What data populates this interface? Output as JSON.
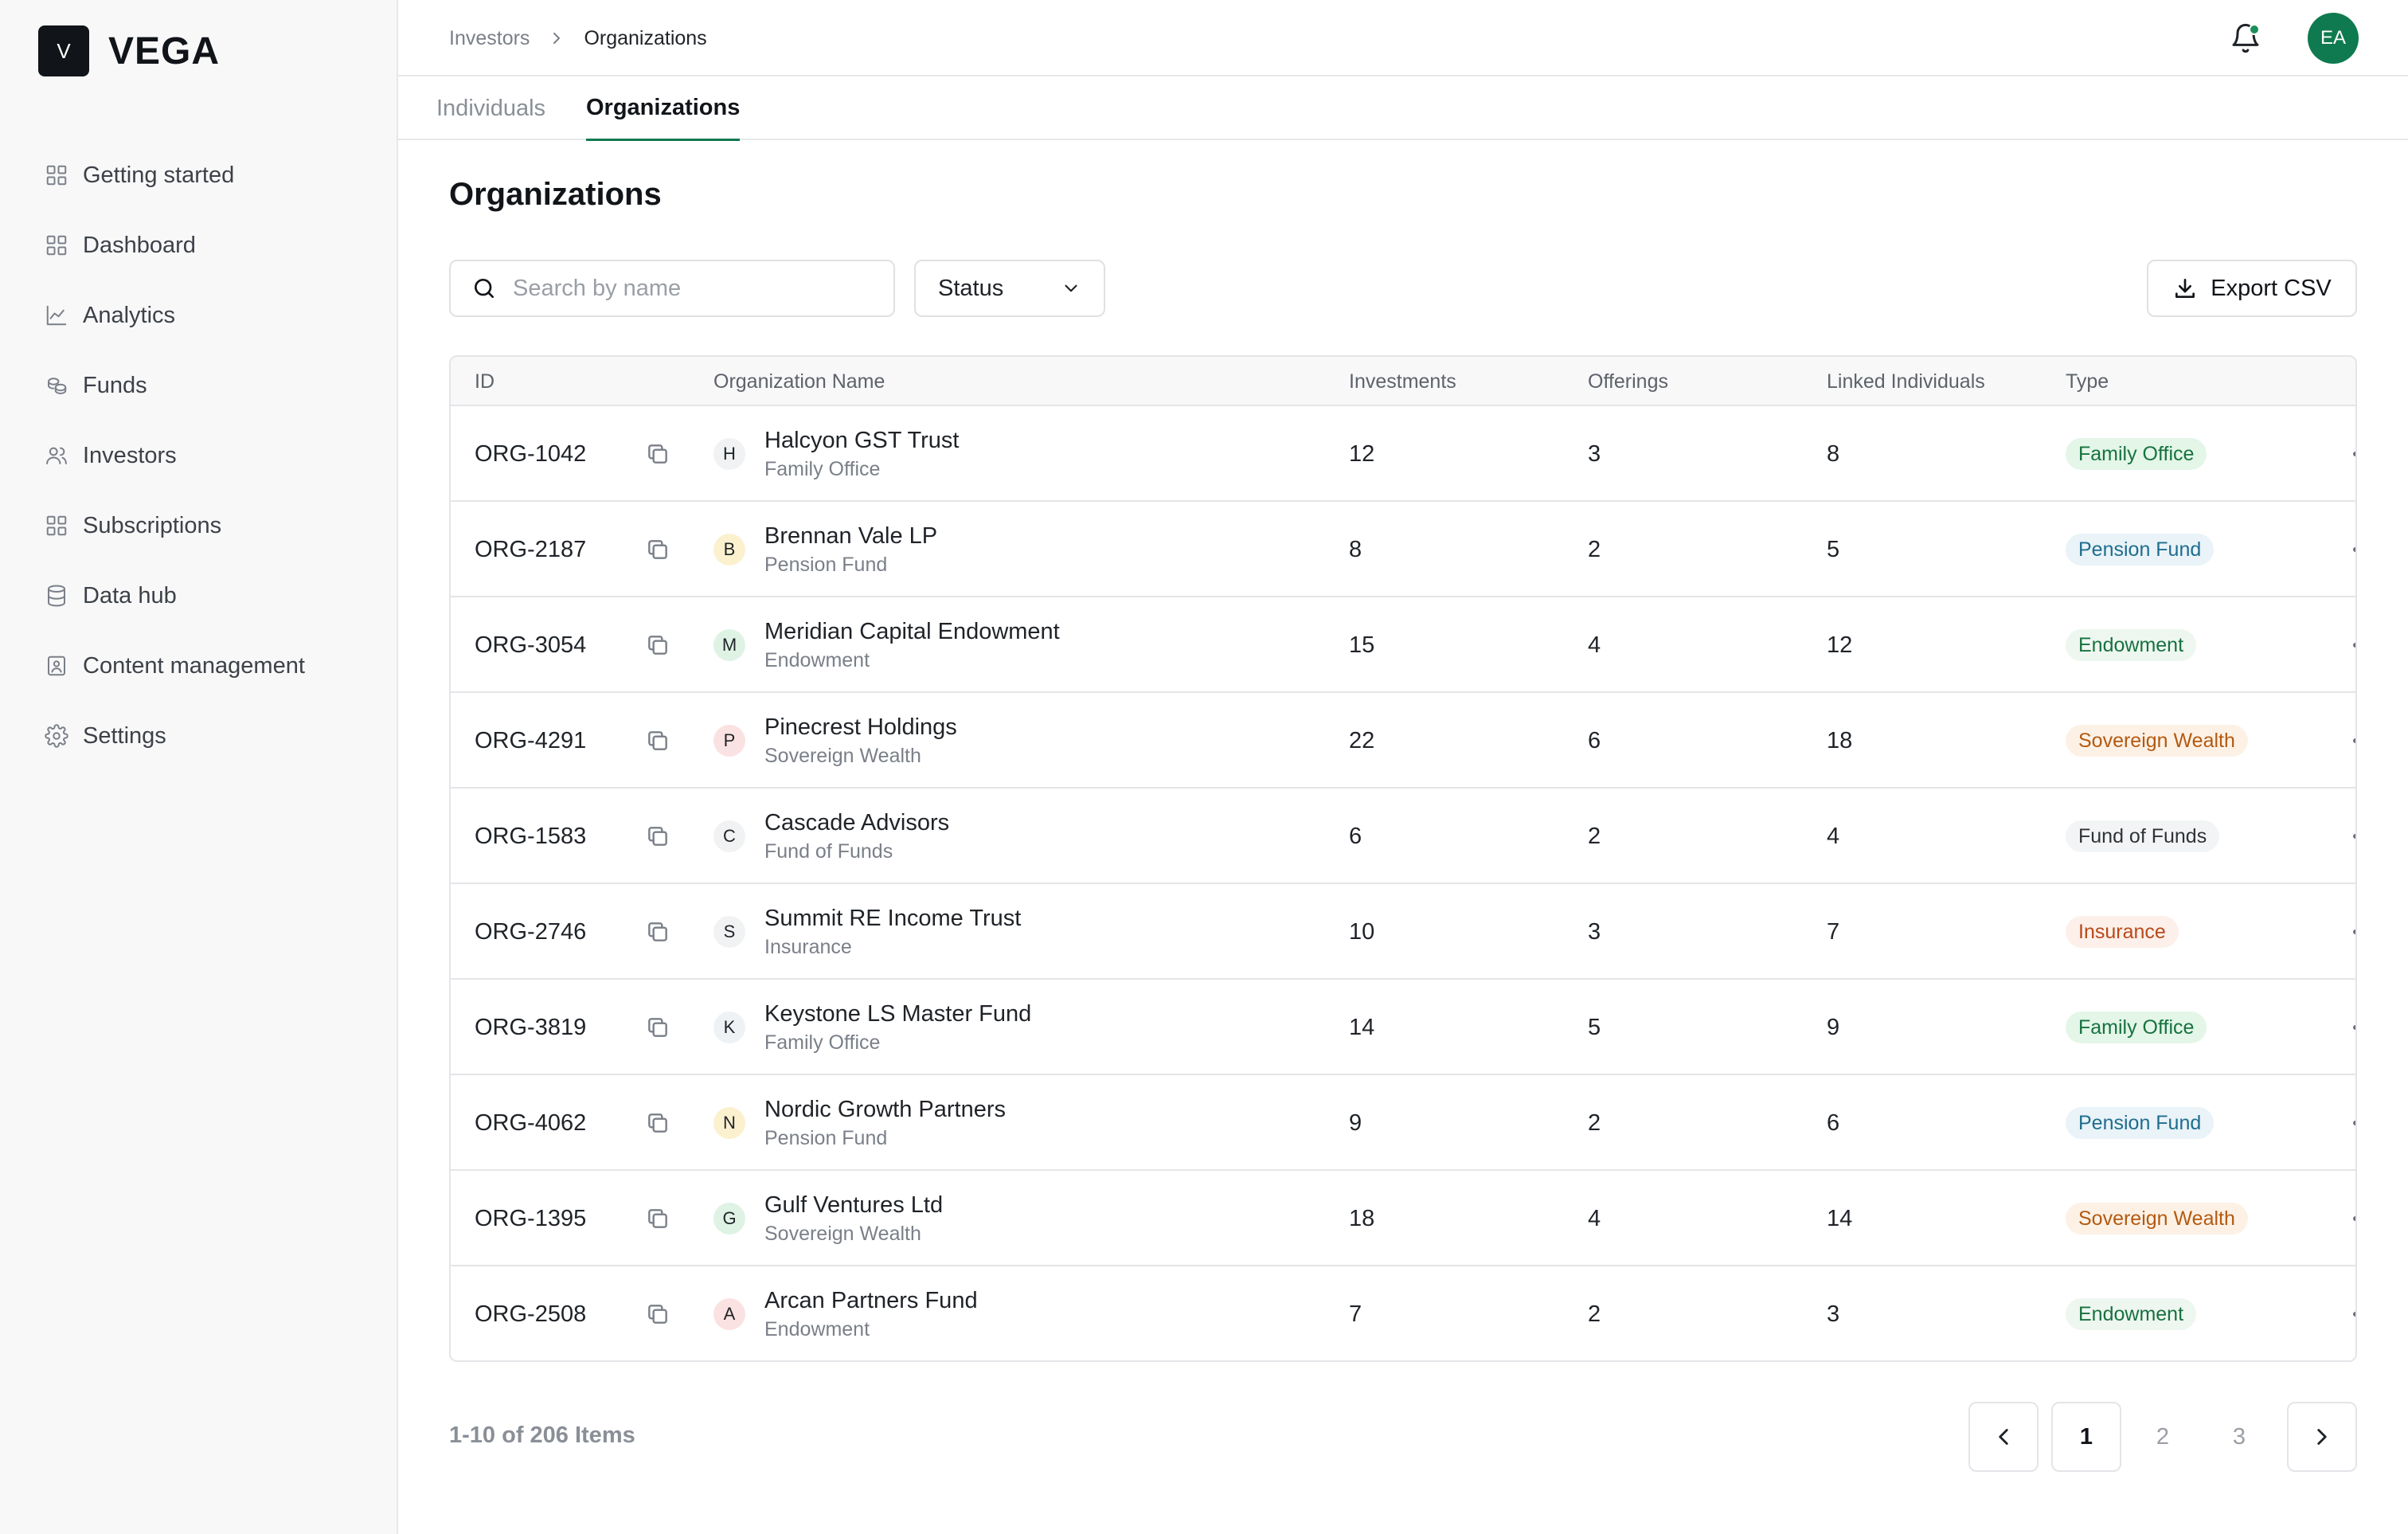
{
  "brand": {
    "mark": "V",
    "name": "VEGA"
  },
  "sidebar": {
    "items": [
      {
        "label": "Getting started",
        "icon": "grid-icon"
      },
      {
        "label": "Dashboard",
        "icon": "grid-icon"
      },
      {
        "label": "Analytics",
        "icon": "chart-line-icon"
      },
      {
        "label": "Funds",
        "icon": "coins-icon"
      },
      {
        "label": "Investors",
        "icon": "users-icon"
      },
      {
        "label": "Subscriptions",
        "icon": "grid-icon"
      },
      {
        "label": "Data hub",
        "icon": "database-icon"
      },
      {
        "label": "Content management",
        "icon": "content-icon"
      },
      {
        "label": "Settings",
        "icon": "gear-icon"
      }
    ]
  },
  "header": {
    "breadcrumb": {
      "parent": "Investors",
      "current": "Organizations"
    },
    "avatar_initials": "EA"
  },
  "tabs": [
    {
      "label": "Individuals",
      "active": false
    },
    {
      "label": "Organizations",
      "active": true
    }
  ],
  "main": {
    "title": "Organizations",
    "search_placeholder": "Search by name",
    "status_filter": "Status",
    "export_label": "Export CSV"
  },
  "table": {
    "columns": [
      "ID",
      "Organization Name",
      "Investments",
      "Offerings",
      "Linked Individuals",
      "Type"
    ],
    "rows": [
      {
        "id": "ORG-1042",
        "initial": "H",
        "name": "Halcyon GST Trust",
        "sub": "Family Office",
        "investments": "12",
        "offerings": "3",
        "linked": "8",
        "type": "Family Office"
      },
      {
        "id": "ORG-2187",
        "initial": "B",
        "name": "Brennan Vale LP",
        "sub": "Pension Fund",
        "investments": "8",
        "offerings": "2",
        "linked": "5",
        "type": "Pension Fund"
      },
      {
        "id": "ORG-3054",
        "initial": "M",
        "name": "Meridian Capital Endowment",
        "sub": "Endowment",
        "investments": "15",
        "offerings": "4",
        "linked": "12",
        "type": "Endowment"
      },
      {
        "id": "ORG-4291",
        "initial": "P",
        "name": "Pinecrest Holdings",
        "sub": "Sovereign Wealth",
        "investments": "22",
        "offerings": "6",
        "linked": "18",
        "type": "Sovereign Wealth"
      },
      {
        "id": "ORG-1583",
        "initial": "C",
        "name": "Cascade Advisors",
        "sub": "Fund of Funds",
        "investments": "6",
        "offerings": "2",
        "linked": "4",
        "type": "Fund of Funds"
      },
      {
        "id": "ORG-2746",
        "initial": "S",
        "name": "Summit RE Income Trust",
        "sub": "Insurance",
        "investments": "10",
        "offerings": "3",
        "linked": "7",
        "type": "Insurance"
      },
      {
        "id": "ORG-3819",
        "initial": "K",
        "name": "Keystone LS Master Fund",
        "sub": "Family Office",
        "investments": "14",
        "offerings": "5",
        "linked": "9",
        "type": "Family Office"
      },
      {
        "id": "ORG-4062",
        "initial": "N",
        "name": "Nordic Growth Partners",
        "sub": "Pension Fund",
        "investments": "9",
        "offerings": "2",
        "linked": "6",
        "type": "Pension Fund"
      },
      {
        "id": "ORG-1395",
        "initial": "G",
        "name": "Gulf Ventures Ltd",
        "sub": "Sovereign Wealth",
        "investments": "18",
        "offerings": "4",
        "linked": "14",
        "type": "Sovereign Wealth"
      },
      {
        "id": "ORG-2508",
        "initial": "A",
        "name": "Arcan Partners Fund",
        "sub": "Endowment",
        "investments": "7",
        "offerings": "2",
        "linked": "3",
        "type": "Endowment"
      }
    ]
  },
  "type_styles": {
    "Family Office": {
      "bg": "#e3f6e8",
      "fg": "#17723f"
    },
    "Pension Fund": {
      "bg": "#e9f3f8",
      "fg": "#1f6d8f"
    },
    "Endowment": {
      "bg": "#eef6f0",
      "fg": "#17723f"
    },
    "Sovereign Wealth": {
      "bg": "#fdf1e6",
      "fg": "#b35a10"
    },
    "Fund of Funds": {
      "bg": "#f3f4f5",
      "fg": "#2f3338"
    },
    "Insurance": {
      "bg": "#fdf0ea",
      "fg": "#b84a1a"
    }
  },
  "avatar_styles": {
    "H": "#f0f2f3",
    "B": "#fbf1cf",
    "M": "#dff3e5",
    "P": "#fbe2e2",
    "C": "#f1f2f3",
    "S": "#f1f2f3",
    "K": "#eef2f5",
    "N": "#fbf1cf",
    "G": "#dff3e5",
    "A": "#fbe2e2"
  },
  "pagination": {
    "summary": "1-10 of 206 Items",
    "pages": [
      "1",
      "2",
      "3"
    ],
    "current_page": "1"
  },
  "colors": {
    "accent": "#0f7a4f",
    "notification_dot": "#1a8f5a"
  }
}
